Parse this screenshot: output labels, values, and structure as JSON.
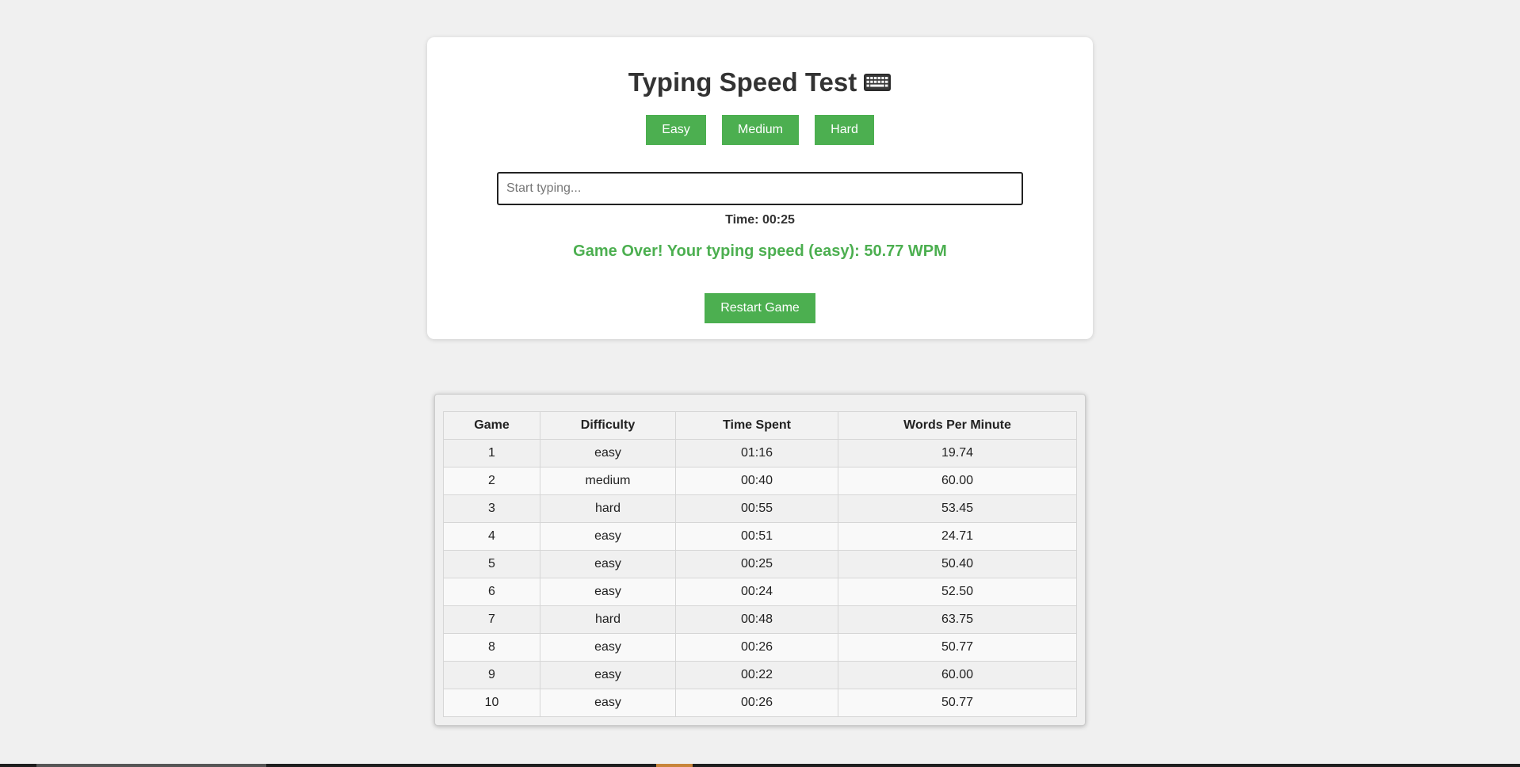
{
  "app": {
    "title": "Typing Speed Test",
    "title_icon": "keyboard-icon",
    "accent_color": "#4caf50"
  },
  "difficulty_buttons": [
    {
      "label": "Easy"
    },
    {
      "label": "Medium"
    },
    {
      "label": "Hard"
    }
  ],
  "input": {
    "placeholder": "Start typing...",
    "value": ""
  },
  "timer": {
    "text": "Time: 00:25"
  },
  "result": {
    "text": "Game Over! Your typing speed (easy): 50.77 WPM"
  },
  "restart": {
    "label": "Restart Game"
  },
  "history": {
    "headers": [
      "Game",
      "Difficulty",
      "Time Spent",
      "Words Per Minute"
    ],
    "rows": [
      [
        "1",
        "easy",
        "01:16",
        "19.74"
      ],
      [
        "2",
        "medium",
        "00:40",
        "60.00"
      ],
      [
        "3",
        "hard",
        "00:55",
        "53.45"
      ],
      [
        "4",
        "easy",
        "00:51",
        "24.71"
      ],
      [
        "5",
        "easy",
        "00:25",
        "50.40"
      ],
      [
        "6",
        "easy",
        "00:24",
        "52.50"
      ],
      [
        "7",
        "hard",
        "00:48",
        "63.75"
      ],
      [
        "8",
        "easy",
        "00:26",
        "50.77"
      ],
      [
        "9",
        "easy",
        "00:22",
        "60.00"
      ],
      [
        "10",
        "easy",
        "00:26",
        "50.77"
      ]
    ]
  }
}
